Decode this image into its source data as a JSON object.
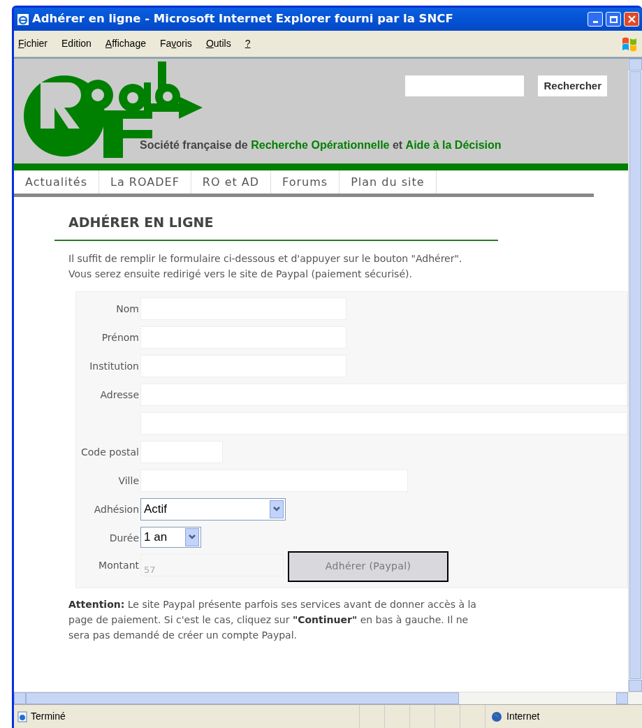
{
  "window": {
    "title": "Adhérer en ligne - Microsoft Internet Explorer fourni par la SNCF"
  },
  "menu": [
    {
      "key": "F",
      "rest": "ichier"
    },
    {
      "rest": "Edition"
    },
    {
      "key": "A",
      "rest": "ffichage"
    },
    {
      "pre": "Fa",
      "key": "v",
      "rest": "oris"
    },
    {
      "key": "O",
      "rest": "utils"
    },
    {
      "key": "?"
    }
  ],
  "header": {
    "search_button": "Rechercher",
    "tagline": "Société française de **Recherche Opérationnelle** et **Aide à la Décision**"
  },
  "nav": [
    "Actualités",
    "La ROADEF",
    "RO et AD",
    "Forums",
    "Plan du site"
  ],
  "page": {
    "heading": "ADHÉRER EN LIGNE",
    "intro": "Il suffit de remplir le formulaire ci-dessous et d'appuyer sur le bouton \"Adhérer\". Vous serez ensuite redirigé vers le site de Paypal (paiement sécurisé).",
    "form": [
      {
        "label": "Nom",
        "kind": "medium"
      },
      {
        "label": "Prénom",
        "kind": "medium"
      },
      {
        "label": "Institution",
        "kind": "medium"
      },
      {
        "label": "Adresse",
        "kind": "wide"
      },
      {
        "kind": "wide"
      },
      {
        "label": "Code postal",
        "kind": "short"
      },
      {
        "label": "Ville",
        "kind": "long"
      },
      {
        "label": "Adhésion",
        "kind": "select",
        "value": "Actif"
      },
      {
        "label": "Durée",
        "kind": "miniselect",
        "value": "1 an"
      },
      {
        "label": "Montant",
        "kind": "amount",
        "value": "57",
        "disabled": true,
        "button": "Adhérer (Paypal)"
      }
    ],
    "note": "**Attention:** Le site Paypal présente parfois ses services avant de donner accès à la page de paiement. Si c'est le cas, cliquez sur **\"Continuer\"** en bas à gauche. Il ne sera pas demandé de créer un compte Paypal."
  },
  "status_bar": {
    "text": "Terminé",
    "zone": "Internet"
  }
}
